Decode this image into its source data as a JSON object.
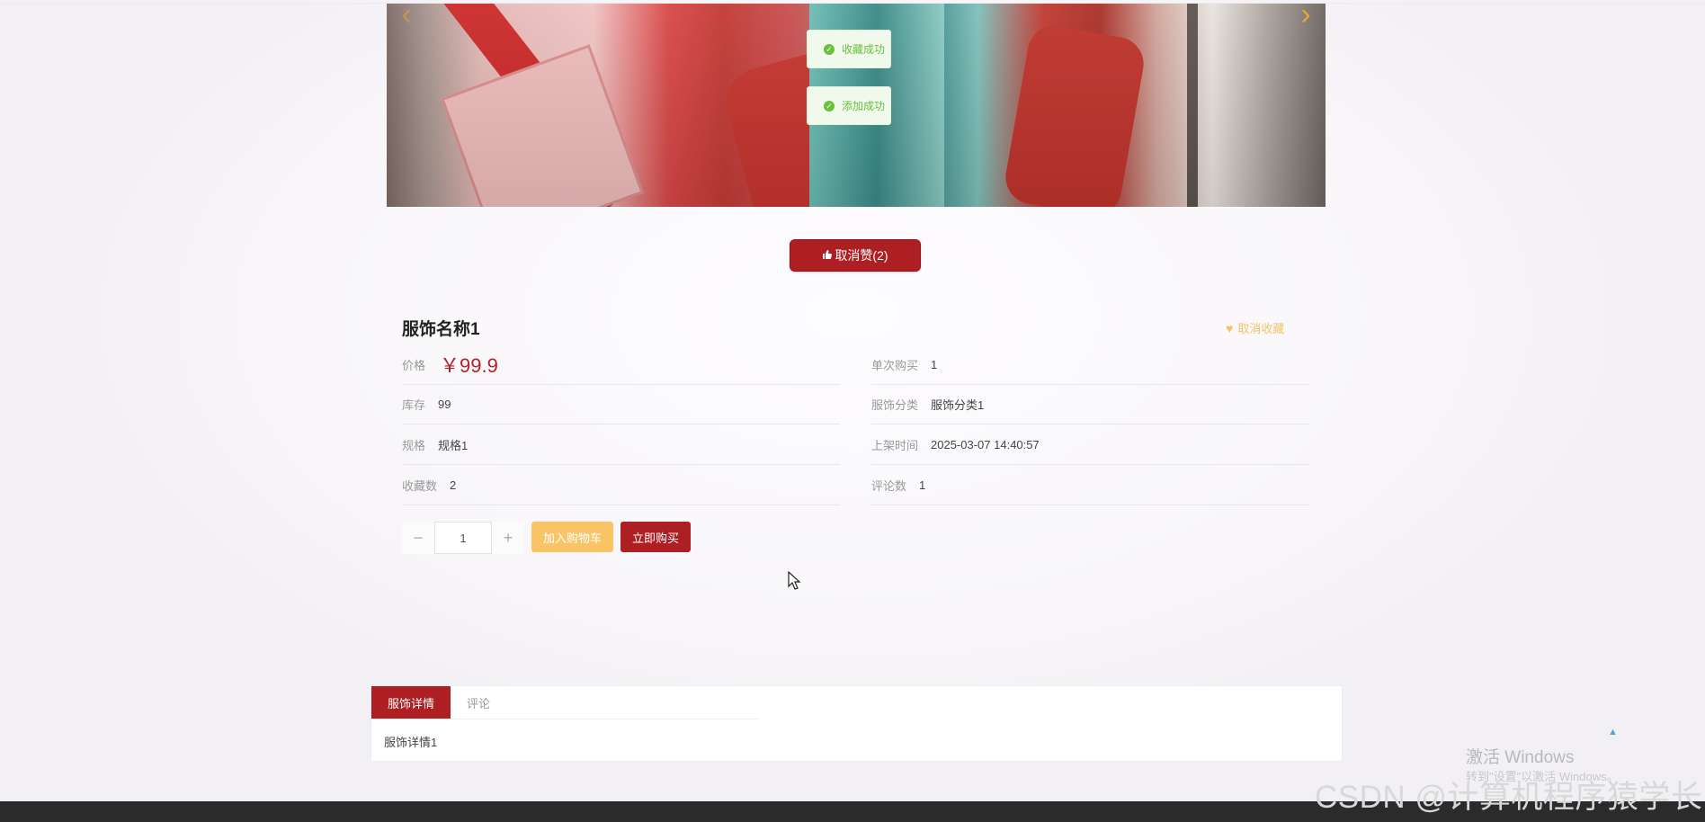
{
  "toasts": [
    {
      "text": "收藏成功"
    },
    {
      "text": "添加成功"
    }
  ],
  "like_button": {
    "label": "取消赞(2)"
  },
  "product": {
    "title": "服饰名称1",
    "favorite_label": "取消收藏",
    "price": {
      "label": "价格",
      "value": "￥99.9"
    },
    "left_rows": [
      {
        "label": "库存",
        "value": "99"
      },
      {
        "label": "规格",
        "value": "规格1"
      },
      {
        "label": "收藏数",
        "value": "2"
      }
    ],
    "right_rows": [
      {
        "label": "单次购买",
        "value": "1"
      },
      {
        "label": "服饰分类",
        "value": "服饰分类1"
      },
      {
        "label": "上架时间",
        "value": "2025-03-07 14:40:57"
      },
      {
        "label": "评论数",
        "value": "1"
      }
    ]
  },
  "quantity": {
    "minus": "−",
    "value": "1",
    "plus": "+"
  },
  "actions": {
    "add_to_cart": "加入购物车",
    "buy_now": "立即购买"
  },
  "tabs": [
    {
      "label": "服饰详情",
      "active": true
    },
    {
      "label": "评论",
      "active": false
    }
  ],
  "tab_content": "服饰详情1",
  "windows": {
    "activate": "激活 Windows",
    "sub": "转到\"设置\"以激活 Windows。"
  },
  "watermark": "CSDN @计算机程序猿学长",
  "colors": {
    "primary": "#ae1f24",
    "cart": "#f9c466",
    "favorite": "#f4c36a",
    "success": "#67c23a",
    "price": "#b42227"
  },
  "icons": [
    "chevron-left-icon",
    "chevron-right-icon",
    "check-circle-icon",
    "thumbs-up-icon",
    "heart-icon",
    "caret-up-icon"
  ]
}
